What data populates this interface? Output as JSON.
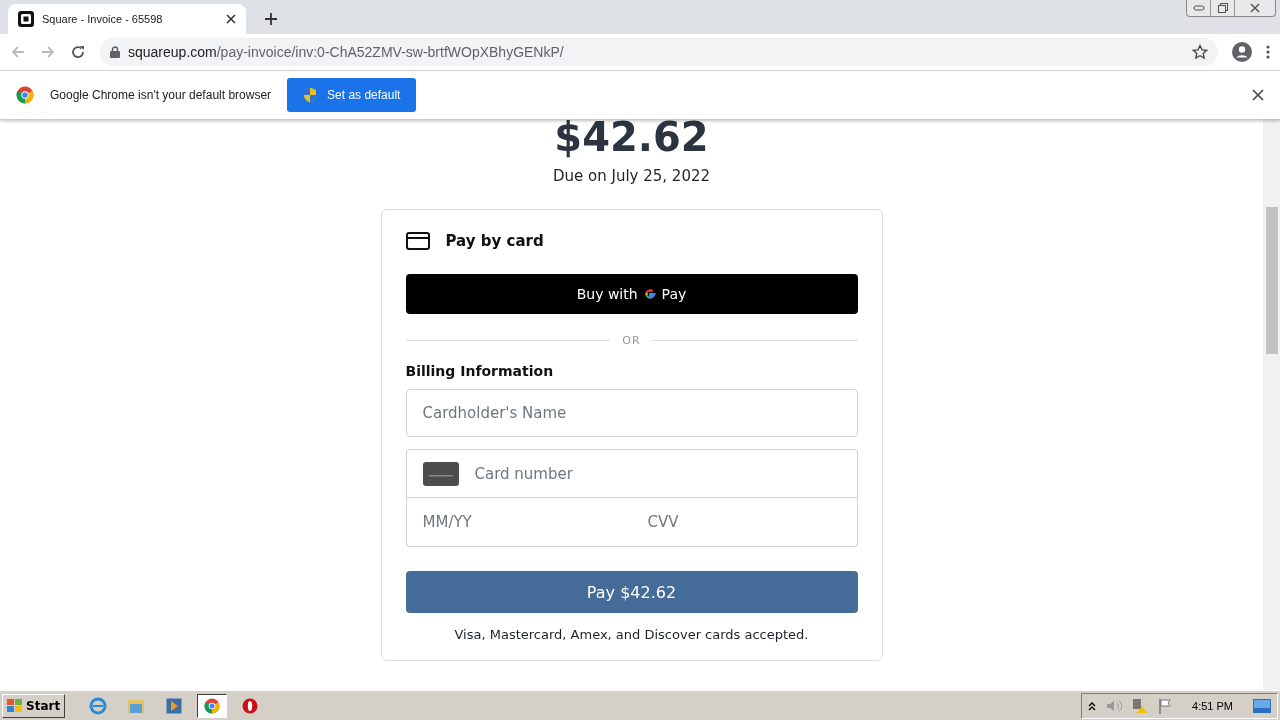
{
  "browser": {
    "tab_title": "Square - Invoice - 65598",
    "url_host": "squareup.com",
    "url_path": "/pay-invoice/inv:0-ChA52ZMV-sw-brtfWOpXBhyGENkP/",
    "infobar_message": "Google Chrome isn't your default browser",
    "infobar_button": "Set as default"
  },
  "invoice": {
    "amount": "$42.62",
    "due": "Due on July 25, 2022"
  },
  "payment": {
    "title": "Pay by card",
    "gpay_prefix": "Buy with",
    "gpay_suffix": "Pay",
    "divider": "OR",
    "billing_label": "Billing Information",
    "name_placeholder": "Cardholder's Name",
    "card_placeholder": "Card number",
    "expiry_placeholder": "MM/YY",
    "cvv_placeholder": "CVV",
    "pay_button": "Pay $42.62",
    "note": "Visa, Mastercard, Amex, and Discover cards accepted."
  },
  "taskbar": {
    "start": "Start",
    "apps": [
      {
        "kind": "ie",
        "selected": false
      },
      {
        "kind": "folder",
        "selected": false
      },
      {
        "kind": "media",
        "selected": false
      },
      {
        "kind": "chrome",
        "selected": true
      },
      {
        "kind": "opera",
        "selected": false
      }
    ],
    "clock": "4:51 PM"
  }
}
